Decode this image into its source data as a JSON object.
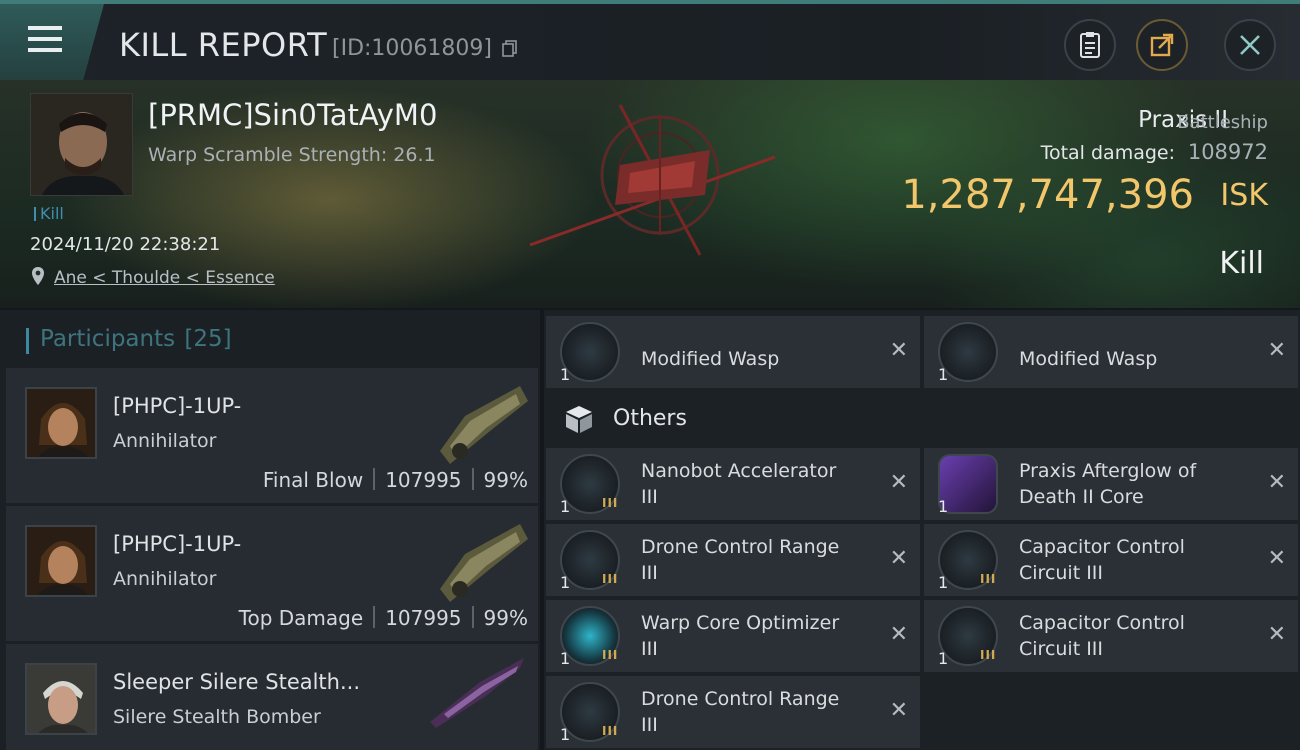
{
  "header": {
    "title": "KILL REPORT",
    "report_id": "[ID:10061809]",
    "icons": [
      "menu-icon",
      "copy-icon",
      "clipboard-icon",
      "share-icon",
      "close-icon"
    ]
  },
  "victim": {
    "name": "[PRMC]Sin0TatAyM0",
    "scram": "Warp Scramble Strength: 26.1",
    "tag": "Kill",
    "date": "2024/11/20 22:38:21",
    "location": "Ane < Thoulde < Essence",
    "ship": "Praxis II",
    "ship_class": "Battleship",
    "damage_label": "Total damage:",
    "damage_value": "108972",
    "isk_value": "1,287,747,396",
    "isk_unit": "ISK",
    "result": "Kill"
  },
  "participants": {
    "title": "Participants",
    "count": "[25]",
    "list": [
      {
        "name": "[PHPC]-1UP-",
        "ship": "Annihilator",
        "role": "Final Blow",
        "damage": "107995",
        "percent": "99%"
      },
      {
        "name": "[PHPC]-1UP-",
        "ship": "Annihilator",
        "role": "Top Damage",
        "damage": "107995",
        "percent": "99%"
      },
      {
        "name": "Sleeper Silere Stealth...",
        "ship": "Silere Stealth Bomber"
      }
    ]
  },
  "drones": [
    {
      "name": "Modified Wasp",
      "qty": "1"
    },
    {
      "name": "Modified Wasp",
      "qty": "1"
    }
  ],
  "others": {
    "title": "Others",
    "items": [
      {
        "line1": "Nanobot Accelerator",
        "line2": "III",
        "qty": "1",
        "meta": "III"
      },
      {
        "line1": "Praxis Afterglow of",
        "line2": "Death II Core",
        "qty": "1",
        "meta": ""
      },
      {
        "line1": "Drone Control Range",
        "line2": "III",
        "qty": "1",
        "meta": "III"
      },
      {
        "line1": "Capacitor Control",
        "line2": "Circuit III",
        "qty": "1",
        "meta": "III"
      },
      {
        "line1": "Warp Core Optimizer",
        "line2": "III",
        "qty": "1",
        "meta": "III"
      },
      {
        "line1": "Capacitor Control",
        "line2": "Circuit III",
        "qty": "1",
        "meta": "III"
      },
      {
        "line1": "Drone Control Range",
        "line2": "III",
        "qty": "1",
        "meta": "III"
      }
    ]
  },
  "remove_symbol": "✕"
}
